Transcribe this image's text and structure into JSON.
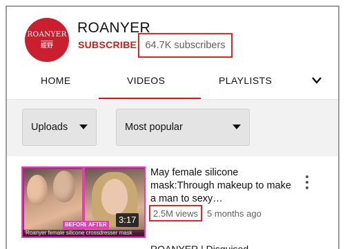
{
  "channel": {
    "avatar_text": "ROANYER",
    "avatar_subtext": "媛野",
    "name": "ROANYER",
    "subscribe_label": "SUBSCRIBE",
    "subscribers": "64.7K subscribers"
  },
  "tabs": [
    {
      "label": "HOME",
      "selected": false
    },
    {
      "label": "VIDEOS",
      "selected": true
    },
    {
      "label": "PLAYLISTS",
      "selected": false
    }
  ],
  "tabs_more_icon": "chevron-down-icon",
  "filters": {
    "uploads": "Uploads",
    "sort": "Most popular"
  },
  "videos": [
    {
      "title": "May female silicone mask:Through makeup to make a man to sexy…",
      "views": "2.5M views",
      "age": "5 months ago",
      "duration": "3:17",
      "thumb_tag_before": "BEFORE",
      "thumb_tag_after": "AFTER",
      "thumb_caption": "Roanyer female silicone crossdresser mask"
    },
    {
      "title": "ROANYER | Disguised"
    }
  ],
  "colors": {
    "accent_red": "#cc1b1b",
    "highlight_box": "#e0242f",
    "thumb_magenta": "#e63cb8"
  }
}
